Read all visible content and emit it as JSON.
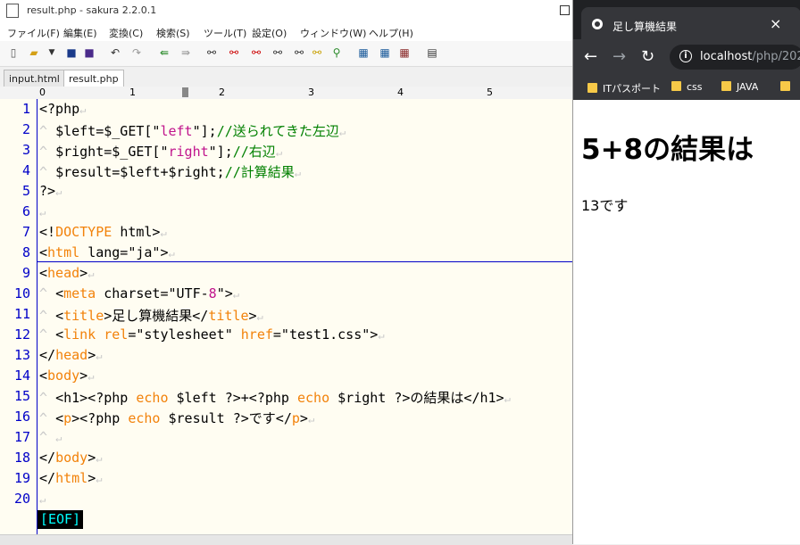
{
  "editor": {
    "title": "result.php - sakura 2.2.0.1",
    "menu": [
      "ファイル(F)",
      "編集(E)",
      "変換(C)",
      "検索(S)",
      "ツール(T)",
      "設定(O)",
      "ウィンドウ(W)",
      "ヘルプ(H)"
    ],
    "tabs": [
      "input.html",
      "result.php"
    ],
    "active_tab": "result.php",
    "ruler": [
      "0",
      "1",
      "2",
      "3",
      "4",
      "5"
    ],
    "line_numbers": [
      "1",
      "2",
      "3",
      "4",
      "5",
      "6",
      "7",
      "8",
      "9",
      "10",
      "11",
      "12",
      "13",
      "14",
      "15",
      "16",
      "17",
      "18",
      "19",
      "20"
    ],
    "lines": [
      "<?php",
      "$left=$_GET[\"left\"];//送られてきた左辺",
      "$right=$_GET[\"right\"];//右辺",
      "$result=$left+$right;//計算結果",
      "?>",
      "",
      "<!DOCTYPE html>",
      "<html lang=\"ja\">",
      "<head>",
      "<meta charset=\"UTF-8\">",
      "<title>足し算機結果</title>",
      "<link rel=\"stylesheet\" href=\"test1.css\">",
      "</head>",
      "<body>",
      "<h1><?php echo $left ?>+<?php echo $right ?>の結果は</h1>",
      "<p><?php echo $result ?>です</p>",
      "",
      "</body>",
      "</html>",
      ""
    ],
    "eof": "[EOF]"
  },
  "browser": {
    "tab_title": "足し算機結果",
    "close_glyph": "×",
    "url_host": "localhost",
    "url_path": "/php/202",
    "bookmarks": [
      "ITパスポート",
      "css",
      "JAVA"
    ],
    "heading": "5+8の結果は",
    "result_text": "13です"
  },
  "colors": {
    "keyword": "#f2820a",
    "string": "#c0148c",
    "comment": "#008000",
    "line_number": "#0000c8",
    "eof_text": "#00ffff",
    "browser_chrome": "#35363a"
  }
}
